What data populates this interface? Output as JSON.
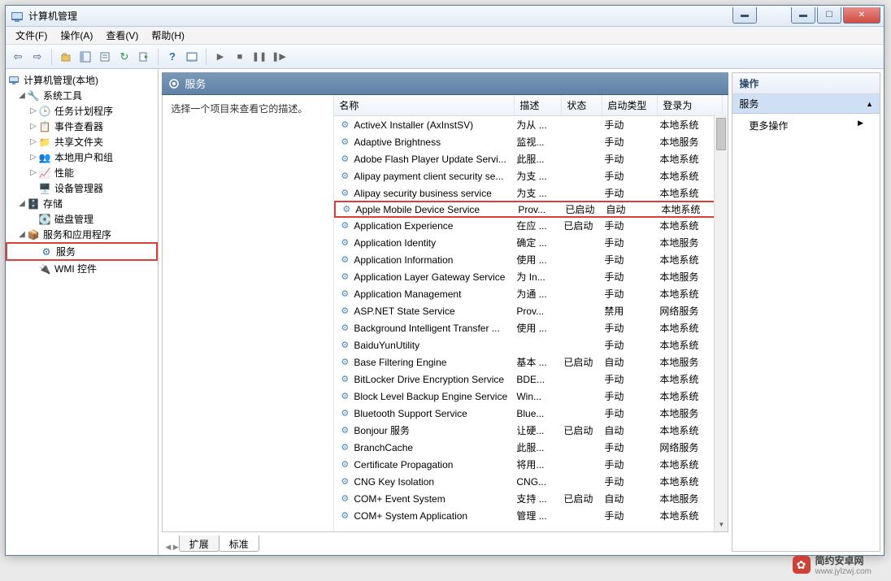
{
  "window": {
    "title": "计算机管理"
  },
  "menu": {
    "file": "文件(F)",
    "action": "操作(A)",
    "view": "查看(V)",
    "help": "帮助(H)"
  },
  "tree": {
    "root": "计算机管理(本地)",
    "systemTools": "系统工具",
    "taskScheduler": "任务计划程序",
    "eventViewer": "事件查看器",
    "sharedFolders": "共享文件夹",
    "localUsers": "本地用户和组",
    "performance": "性能",
    "deviceManager": "设备管理器",
    "storage": "存储",
    "diskMgmt": "磁盘管理",
    "servicesApps": "服务和应用程序",
    "services": "服务",
    "wmi": "WMI 控件"
  },
  "centerHeader": "服务",
  "descPrompt": "选择一个项目来查看它的描述。",
  "columns": {
    "name": "名称",
    "desc": "描述",
    "status": "状态",
    "start": "启动类型",
    "logon": "登录为"
  },
  "tabs": {
    "extended": "扩展",
    "standard": "标准"
  },
  "actions": {
    "title": "操作",
    "group": "服务",
    "more": "更多操作"
  },
  "services": [
    {
      "name": "ActiveX Installer (AxInstSV)",
      "desc": "为从 ...",
      "status": "",
      "start": "手动",
      "logon": "本地系统"
    },
    {
      "name": "Adaptive Brightness",
      "desc": "监视...",
      "status": "",
      "start": "手动",
      "logon": "本地服务"
    },
    {
      "name": "Adobe Flash Player Update Servi...",
      "desc": "此服...",
      "status": "",
      "start": "手动",
      "logon": "本地系统"
    },
    {
      "name": "Alipay payment client security se...",
      "desc": "为支 ...",
      "status": "",
      "start": "手动",
      "logon": "本地系统"
    },
    {
      "name": "Alipay security business service",
      "desc": "为支 ...",
      "status": "",
      "start": "手动",
      "logon": "本地系统"
    },
    {
      "name": "Apple Mobile Device Service",
      "desc": "Prov...",
      "status": "已启动",
      "start": "自动",
      "logon": "本地系统",
      "hl": true
    },
    {
      "name": "Application Experience",
      "desc": "在应 ...",
      "status": "已启动",
      "start": "手动",
      "logon": "本地系统"
    },
    {
      "name": "Application Identity",
      "desc": "确定 ...",
      "status": "",
      "start": "手动",
      "logon": "本地服务"
    },
    {
      "name": "Application Information",
      "desc": "使用 ...",
      "status": "",
      "start": "手动",
      "logon": "本地系统"
    },
    {
      "name": "Application Layer Gateway Service",
      "desc": "为 In...",
      "status": "",
      "start": "手动",
      "logon": "本地服务"
    },
    {
      "name": "Application Management",
      "desc": "为通 ...",
      "status": "",
      "start": "手动",
      "logon": "本地系统"
    },
    {
      "name": "ASP.NET State Service",
      "desc": "Prov...",
      "status": "",
      "start": "禁用",
      "logon": "网络服务"
    },
    {
      "name": "Background Intelligent Transfer ...",
      "desc": "使用 ...",
      "status": "",
      "start": "手动",
      "logon": "本地系统"
    },
    {
      "name": "BaiduYunUtility",
      "desc": "",
      "status": "",
      "start": "手动",
      "logon": "本地系统"
    },
    {
      "name": "Base Filtering Engine",
      "desc": "基本 ...",
      "status": "已启动",
      "start": "自动",
      "logon": "本地服务"
    },
    {
      "name": "BitLocker Drive Encryption Service",
      "desc": "BDE...",
      "status": "",
      "start": "手动",
      "logon": "本地系统"
    },
    {
      "name": "Block Level Backup Engine Service",
      "desc": "Win...",
      "status": "",
      "start": "手动",
      "logon": "本地系统"
    },
    {
      "name": "Bluetooth Support Service",
      "desc": "Blue...",
      "status": "",
      "start": "手动",
      "logon": "本地服务"
    },
    {
      "name": "Bonjour 服务",
      "desc": "让硬...",
      "status": "已启动",
      "start": "自动",
      "logon": "本地系统"
    },
    {
      "name": "BranchCache",
      "desc": "此服...",
      "status": "",
      "start": "手动",
      "logon": "网络服务"
    },
    {
      "name": "Certificate Propagation",
      "desc": "将用...",
      "status": "",
      "start": "手动",
      "logon": "本地系统"
    },
    {
      "name": "CNG Key Isolation",
      "desc": "CNG...",
      "status": "",
      "start": "手动",
      "logon": "本地系统"
    },
    {
      "name": "COM+ Event System",
      "desc": "支持 ...",
      "status": "已启动",
      "start": "自动",
      "logon": "本地服务"
    },
    {
      "name": "COM+ System Application",
      "desc": "管理 ...",
      "status": "",
      "start": "手动",
      "logon": "本地系统"
    }
  ],
  "watermark": {
    "brand": "简约安卓网",
    "url": "www.jylzwj.com"
  }
}
